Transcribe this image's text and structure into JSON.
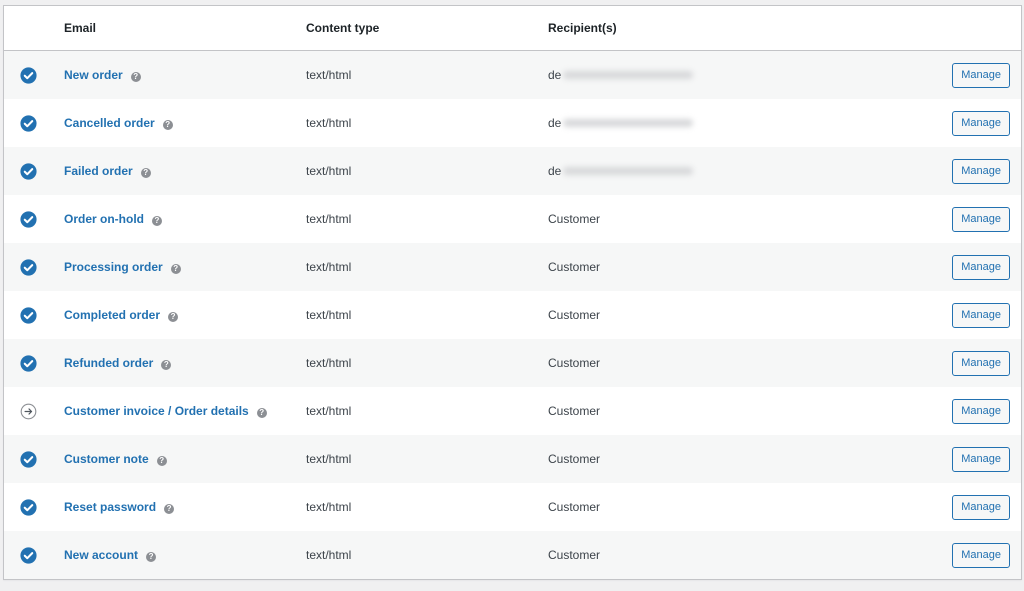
{
  "columns": {
    "status": "",
    "email": "Email",
    "content_type": "Content type",
    "recipients": "Recipient(s)",
    "actions": ""
  },
  "colors": {
    "accent": "#2271b1",
    "enabled_icon": "#2271b1",
    "manual_icon": "#8c8f94"
  },
  "rows": [
    {
      "status": "enabled",
      "status_icon": "check-circle-icon",
      "name": "New order",
      "content_type": "text/html",
      "recipient": "de",
      "recipient_blurred": true,
      "action": "Manage"
    },
    {
      "status": "enabled",
      "status_icon": "check-circle-icon",
      "name": "Cancelled order",
      "content_type": "text/html",
      "recipient": "de",
      "recipient_blurred": true,
      "action": "Manage"
    },
    {
      "status": "enabled",
      "status_icon": "check-circle-icon",
      "name": "Failed order",
      "content_type": "text/html",
      "recipient": "de",
      "recipient_blurred": true,
      "action": "Manage"
    },
    {
      "status": "enabled",
      "status_icon": "check-circle-icon",
      "name": "Order on-hold",
      "content_type": "text/html",
      "recipient": "Customer",
      "recipient_blurred": false,
      "action": "Manage"
    },
    {
      "status": "enabled",
      "status_icon": "check-circle-icon",
      "name": "Processing order",
      "content_type": "text/html",
      "recipient": "Customer",
      "recipient_blurred": false,
      "action": "Manage"
    },
    {
      "status": "enabled",
      "status_icon": "check-circle-icon",
      "name": "Completed order",
      "content_type": "text/html",
      "recipient": "Customer",
      "recipient_blurred": false,
      "action": "Manage"
    },
    {
      "status": "enabled",
      "status_icon": "check-circle-icon",
      "name": "Refunded order",
      "content_type": "text/html",
      "recipient": "Customer",
      "recipient_blurred": false,
      "action": "Manage"
    },
    {
      "status": "manual",
      "status_icon": "arrow-right-circle-icon",
      "name": "Customer invoice / Order details",
      "content_type": "text/html",
      "recipient": "Customer",
      "recipient_blurred": false,
      "action": "Manage"
    },
    {
      "status": "enabled",
      "status_icon": "check-circle-icon",
      "name": "Customer note",
      "content_type": "text/html",
      "recipient": "Customer",
      "recipient_blurred": false,
      "action": "Manage"
    },
    {
      "status": "enabled",
      "status_icon": "check-circle-icon",
      "name": "Reset password",
      "content_type": "text/html",
      "recipient": "Customer",
      "recipient_blurred": false,
      "action": "Manage"
    },
    {
      "status": "enabled",
      "status_icon": "check-circle-icon",
      "name": "New account",
      "content_type": "text/html",
      "recipient": "Customer",
      "recipient_blurred": false,
      "action": "Manage"
    }
  ],
  "help_icon_glyph": "?"
}
